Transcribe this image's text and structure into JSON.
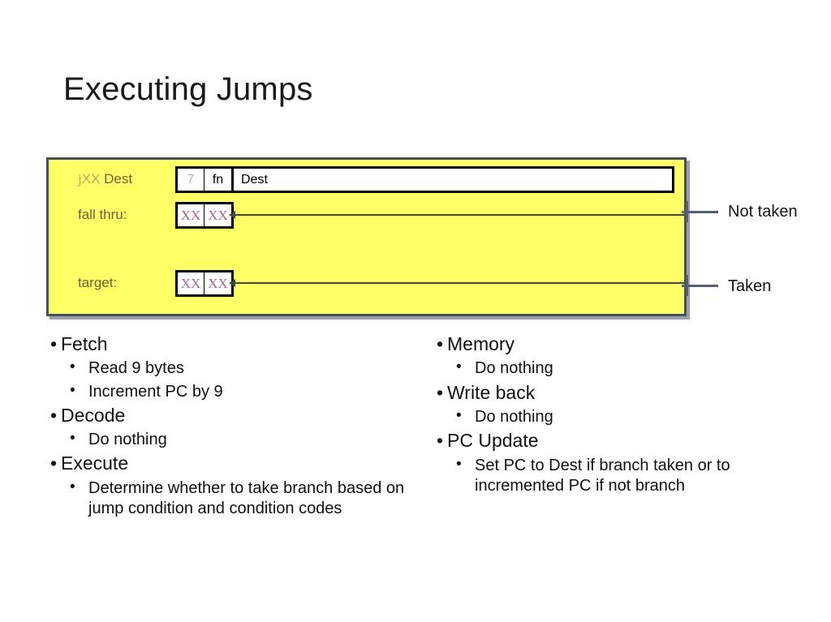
{
  "slide": {
    "title": "Executing Jumps"
  },
  "diagram": {
    "rows": [
      {
        "label_plain": "jXX Dest",
        "label_prefix": "j",
        "label_dim": "XX",
        "label_rest": " Dest",
        "cells": [
          "7",
          "fn",
          "Dest"
        ]
      },
      {
        "label_plain": "fall thru:",
        "cells": [
          "XX",
          "XX"
        ],
        "connector": "Not taken"
      },
      {
        "label_plain": "target:",
        "cells": [
          "XX",
          "XX"
        ],
        "connector": "Taken"
      }
    ],
    "side_labels": [
      "Not taken",
      "Taken"
    ],
    "colors": {
      "panel_fill": "#ffff66",
      "panel_border": "#454f63",
      "label_text": "#7a5c3a",
      "dim_text": "#b9a86a",
      "xx_text": "#a86b8e",
      "connector_line": "#3f4a2e",
      "outer_line": "#555f72"
    }
  },
  "stages": {
    "left": [
      {
        "level": 1,
        "text": "Fetch"
      },
      {
        "level": 2,
        "text": "Read 9 bytes"
      },
      {
        "level": 2,
        "text": "Increment PC by 9"
      },
      {
        "level": 1,
        "text": "Decode"
      },
      {
        "level": 2,
        "text": "Do nothing"
      },
      {
        "level": 1,
        "text": "Execute"
      },
      {
        "level": 2,
        "text": "Determine whether to take branch based on jump condition and condition codes"
      }
    ],
    "right": [
      {
        "level": 1,
        "text": "Memory"
      },
      {
        "level": 2,
        "text": "Do nothing"
      },
      {
        "level": 1,
        "text": "Write back"
      },
      {
        "level": 2,
        "text": "Do nothing"
      },
      {
        "level": 1,
        "text": "PC Update"
      },
      {
        "level": 2,
        "text": "Set PC to Dest if branch taken or to incremented PC if not branch"
      }
    ]
  }
}
